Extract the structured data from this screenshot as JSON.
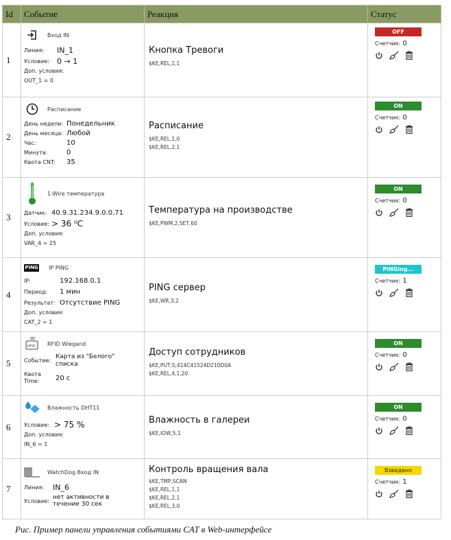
{
  "headers": {
    "id": "Id",
    "event": "Событие",
    "reaction": "Реакция",
    "status": "Статус"
  },
  "counter_label": "Счетчик:",
  "rows": [
    {
      "id": "1",
      "event_type": "Вход IN",
      "icon": "input-arrow-icon",
      "fields": [
        {
          "label": "Линия:",
          "value": "IN_1"
        },
        {
          "label": "Условие:",
          "value": "0 → 1"
        }
      ],
      "extra_label": "Доп. условия:",
      "extra_value": "OUT_1 = 0",
      "reaction_title": "Кнопка Тревоги",
      "commands": [
        "$KE,REL,1,1"
      ],
      "status": "OFF",
      "status_color": "#c62828",
      "counter": "0"
    },
    {
      "id": "2",
      "event_type": "Расписание",
      "icon": "clock-icon",
      "fields": [
        {
          "label": "День недели:",
          "value": "Понедельник"
        },
        {
          "label": "День месяца:",
          "value": "Любой"
        },
        {
          "label": "Час:",
          "value": "10"
        },
        {
          "label": "Минута:",
          "value": "0"
        },
        {
          "label": "Квота CNT:",
          "value": "35"
        }
      ],
      "reaction_title": "Расписание",
      "commands": [
        "$KE,REL,1,0",
        "$KE,REL,2,1"
      ],
      "status": "ON",
      "status_color": "#2e8b2e",
      "counter": "0"
    },
    {
      "id": "3",
      "event_type": "1-Wire температура",
      "icon": "thermometer-icon",
      "fields": [
        {
          "label": "Датчик:",
          "value": "40.9.31.234.9.0.0.71"
        },
        {
          "label": "Условие:",
          "value": "> 36 ⁰C"
        }
      ],
      "extra_label": "Доп. условия:",
      "extra_value": "VAR_4 = 25",
      "reaction_title": "Температура на производстве",
      "commands": [
        "$KE,PWM,2,SET,60"
      ],
      "status": "ON",
      "status_color": "#2e8b2e",
      "counter": "0"
    },
    {
      "id": "4",
      "event_type": "IP PING",
      "icon": "ping-icon",
      "icon_text": "PING",
      "fields": [
        {
          "label": "IP:",
          "value": "192.168.0.1"
        },
        {
          "label": "Период:",
          "value": "1 мин"
        },
        {
          "label": "Результат:",
          "value": "Отсутствие PING"
        }
      ],
      "extra_label": "Доп. условия:",
      "extra_value": "CAT_2 = 1",
      "reaction_title": "PING сервер",
      "commands": [
        "$KE,WR,3,2"
      ],
      "status": "PINGing...",
      "status_color": "#20c4cc",
      "counter": "1"
    },
    {
      "id": "5",
      "event_type": "RFID Wiegand",
      "icon": "rfid-icon",
      "icon_text": "RFID",
      "fields": [
        {
          "label": "Событие:",
          "value": "Карта из \"Белого\" списка"
        },
        {
          "label": "Квота Time:",
          "value": "20 с"
        }
      ],
      "reaction_title": "Доступ сотрудников",
      "commands": [
        "$KE,PUT,S,414C41524D210D0A",
        "$KE,REL,4,1,20"
      ],
      "status": "ON",
      "status_color": "#2e8b2e",
      "counter": "0"
    },
    {
      "id": "6",
      "event_type": "Влажность DHT11",
      "icon": "humidity-icon",
      "fields": [
        {
          "label": "Условие:",
          "value": "> 75 %"
        }
      ],
      "extra_label": "Доп. условия:",
      "extra_value": "IN_6 = 1",
      "reaction_title": "Влажность в галереи",
      "commands": [
        "$KE,IOW,5,1"
      ],
      "status": "ON",
      "status_color": "#2e8b2e",
      "counter": "0"
    },
    {
      "id": "7",
      "event_type": "WatchDog Вход IN",
      "icon": "watchdog-pulse-icon",
      "fields": [
        {
          "label": "Линия:",
          "value": "IN_6"
        },
        {
          "label": "Условие:",
          "value": "нет активности в течение 30 сек"
        }
      ],
      "reaction_title": "Контроль вращения вала",
      "commands": [
        "$KE,TMP,SCAN",
        "$KE,REL,1,1",
        "$KE,REL,2,1",
        "$KE,REL,3,0"
      ],
      "status": "Взведено",
      "status_color": "#f5d800",
      "counter": "1"
    }
  ],
  "caption": "Рис. Пример панели управления событиями CAT в Web-интерфейсе"
}
